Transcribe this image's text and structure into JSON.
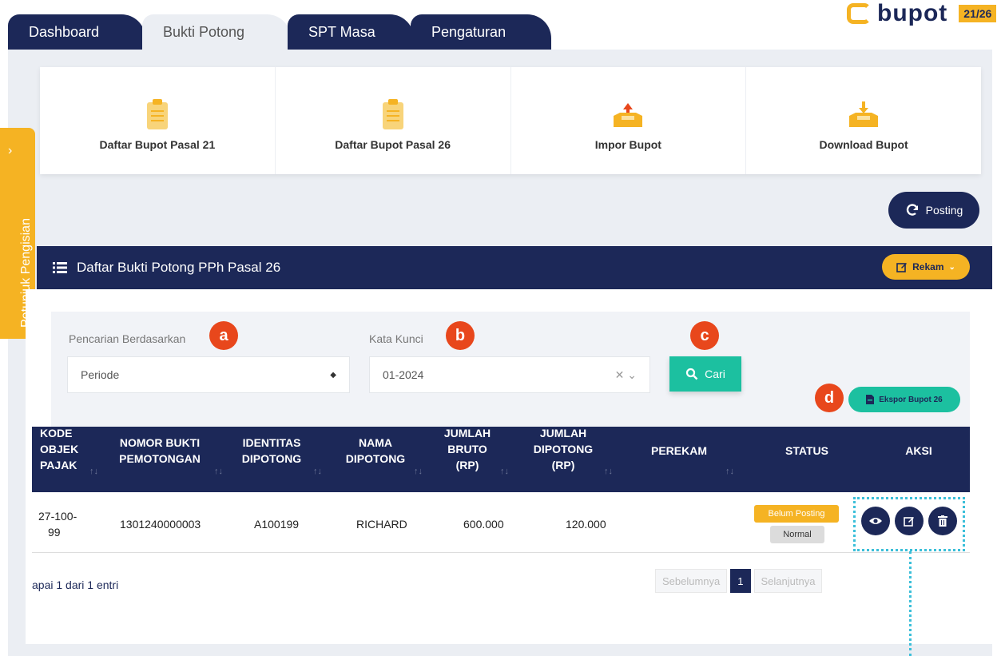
{
  "tabs": [
    "Dashboard",
    "Bukti Potong",
    "SPT Masa",
    "Pengaturan"
  ],
  "logo": {
    "text": "bupot",
    "badge": "21/26"
  },
  "cards": [
    "Daftar Bupot Pasal 21",
    "Daftar Bupot Pasal 26",
    "Impor Bupot",
    "Download Bupot"
  ],
  "side_tab_label": "Petunjuk Pengisian",
  "posting_label": "Posting",
  "list_title": "Daftar Bukti Potong PPh Pasal 26",
  "rekam_label": "Rekam",
  "filter": {
    "search_by_label": "Pencarian Berdasarkan",
    "search_by_value": "Periode",
    "keyword_label": "Kata Kunci",
    "keyword_value": "01-2024",
    "cari_label": "Cari",
    "ekspor_label": "Ekspor Bupot 26"
  },
  "markers": [
    "a",
    "b",
    "c",
    "d"
  ],
  "table": {
    "headers": [
      [
        "KODE",
        "OBJEK",
        "PAJAK"
      ],
      [
        "NOMOR BUKTI",
        "PEMOTONGAN"
      ],
      [
        "IDENTITAS",
        "DIPOTONG"
      ],
      [
        "NAMA",
        "DIPOTONG"
      ],
      [
        "JUMLAH",
        "BRUTO",
        "(RP)"
      ],
      [
        "JUMLAH",
        "DIPOTONG",
        "(RP)"
      ],
      [
        "PEREKAM"
      ],
      [
        "STATUS"
      ],
      [
        "AKSI"
      ]
    ],
    "row": {
      "kode": [
        "27-100-",
        "99"
      ],
      "nomor": "1301240000003",
      "identitas": "A100199",
      "nama": "RICHARD",
      "bruto": "600.000",
      "dipotong": "120.000",
      "perekam": "",
      "status_posting": "Belum Posting",
      "status_type": "Normal"
    }
  },
  "info_text": "apai 1 dari 1 entri",
  "pagination": {
    "prev": "Sebelumnya",
    "page": "1",
    "next": "Selanjutnya"
  },
  "colors": {
    "navy": "#1c2858",
    "yellow": "#f5b323",
    "teal": "#1cc0a0",
    "marker": "#e8471c"
  }
}
